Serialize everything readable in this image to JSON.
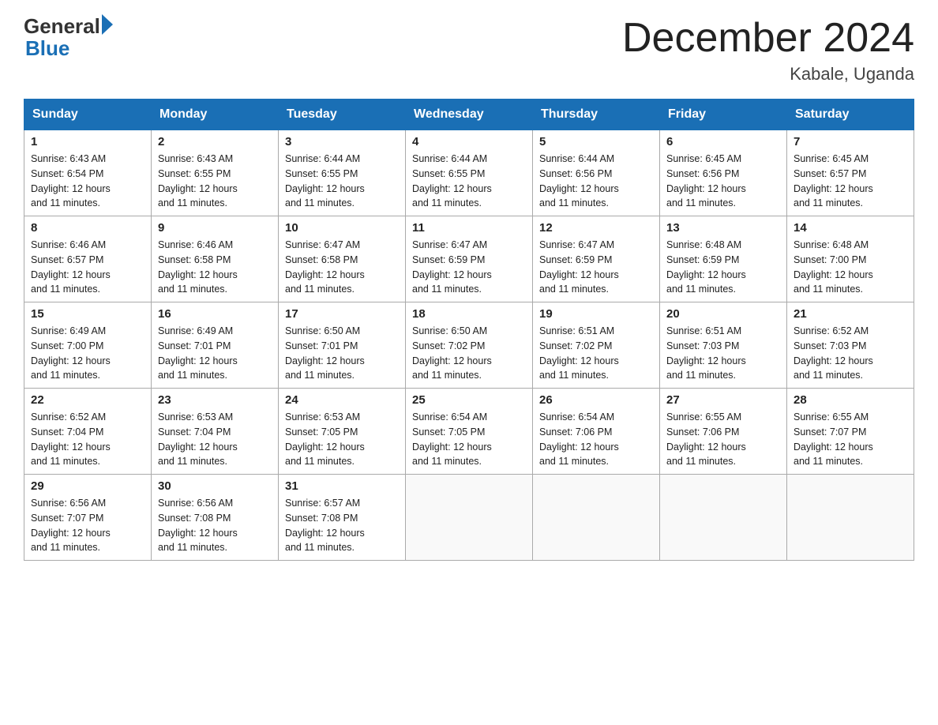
{
  "header": {
    "logo_general": "General",
    "logo_blue": "Blue",
    "title": "December 2024",
    "location": "Kabale, Uganda"
  },
  "days_of_week": [
    "Sunday",
    "Monday",
    "Tuesday",
    "Wednesday",
    "Thursday",
    "Friday",
    "Saturday"
  ],
  "weeks": [
    [
      {
        "num": "1",
        "sunrise": "6:43 AM",
        "sunset": "6:54 PM",
        "daylight": "12 hours and 11 minutes."
      },
      {
        "num": "2",
        "sunrise": "6:43 AM",
        "sunset": "6:55 PM",
        "daylight": "12 hours and 11 minutes."
      },
      {
        "num": "3",
        "sunrise": "6:44 AM",
        "sunset": "6:55 PM",
        "daylight": "12 hours and 11 minutes."
      },
      {
        "num": "4",
        "sunrise": "6:44 AM",
        "sunset": "6:55 PM",
        "daylight": "12 hours and 11 minutes."
      },
      {
        "num": "5",
        "sunrise": "6:44 AM",
        "sunset": "6:56 PM",
        "daylight": "12 hours and 11 minutes."
      },
      {
        "num": "6",
        "sunrise": "6:45 AM",
        "sunset": "6:56 PM",
        "daylight": "12 hours and 11 minutes."
      },
      {
        "num": "7",
        "sunrise": "6:45 AM",
        "sunset": "6:57 PM",
        "daylight": "12 hours and 11 minutes."
      }
    ],
    [
      {
        "num": "8",
        "sunrise": "6:46 AM",
        "sunset": "6:57 PM",
        "daylight": "12 hours and 11 minutes."
      },
      {
        "num": "9",
        "sunrise": "6:46 AM",
        "sunset": "6:58 PM",
        "daylight": "12 hours and 11 minutes."
      },
      {
        "num": "10",
        "sunrise": "6:47 AM",
        "sunset": "6:58 PM",
        "daylight": "12 hours and 11 minutes."
      },
      {
        "num": "11",
        "sunrise": "6:47 AM",
        "sunset": "6:59 PM",
        "daylight": "12 hours and 11 minutes."
      },
      {
        "num": "12",
        "sunrise": "6:47 AM",
        "sunset": "6:59 PM",
        "daylight": "12 hours and 11 minutes."
      },
      {
        "num": "13",
        "sunrise": "6:48 AM",
        "sunset": "6:59 PM",
        "daylight": "12 hours and 11 minutes."
      },
      {
        "num": "14",
        "sunrise": "6:48 AM",
        "sunset": "7:00 PM",
        "daylight": "12 hours and 11 minutes."
      }
    ],
    [
      {
        "num": "15",
        "sunrise": "6:49 AM",
        "sunset": "7:00 PM",
        "daylight": "12 hours and 11 minutes."
      },
      {
        "num": "16",
        "sunrise": "6:49 AM",
        "sunset": "7:01 PM",
        "daylight": "12 hours and 11 minutes."
      },
      {
        "num": "17",
        "sunrise": "6:50 AM",
        "sunset": "7:01 PM",
        "daylight": "12 hours and 11 minutes."
      },
      {
        "num": "18",
        "sunrise": "6:50 AM",
        "sunset": "7:02 PM",
        "daylight": "12 hours and 11 minutes."
      },
      {
        "num": "19",
        "sunrise": "6:51 AM",
        "sunset": "7:02 PM",
        "daylight": "12 hours and 11 minutes."
      },
      {
        "num": "20",
        "sunrise": "6:51 AM",
        "sunset": "7:03 PM",
        "daylight": "12 hours and 11 minutes."
      },
      {
        "num": "21",
        "sunrise": "6:52 AM",
        "sunset": "7:03 PM",
        "daylight": "12 hours and 11 minutes."
      }
    ],
    [
      {
        "num": "22",
        "sunrise": "6:52 AM",
        "sunset": "7:04 PM",
        "daylight": "12 hours and 11 minutes."
      },
      {
        "num": "23",
        "sunrise": "6:53 AM",
        "sunset": "7:04 PM",
        "daylight": "12 hours and 11 minutes."
      },
      {
        "num": "24",
        "sunrise": "6:53 AM",
        "sunset": "7:05 PM",
        "daylight": "12 hours and 11 minutes."
      },
      {
        "num": "25",
        "sunrise": "6:54 AM",
        "sunset": "7:05 PM",
        "daylight": "12 hours and 11 minutes."
      },
      {
        "num": "26",
        "sunrise": "6:54 AM",
        "sunset": "7:06 PM",
        "daylight": "12 hours and 11 minutes."
      },
      {
        "num": "27",
        "sunrise": "6:55 AM",
        "sunset": "7:06 PM",
        "daylight": "12 hours and 11 minutes."
      },
      {
        "num": "28",
        "sunrise": "6:55 AM",
        "sunset": "7:07 PM",
        "daylight": "12 hours and 11 minutes."
      }
    ],
    [
      {
        "num": "29",
        "sunrise": "6:56 AM",
        "sunset": "7:07 PM",
        "daylight": "12 hours and 11 minutes."
      },
      {
        "num": "30",
        "sunrise": "6:56 AM",
        "sunset": "7:08 PM",
        "daylight": "12 hours and 11 minutes."
      },
      {
        "num": "31",
        "sunrise": "6:57 AM",
        "sunset": "7:08 PM",
        "daylight": "12 hours and 11 minutes."
      },
      null,
      null,
      null,
      null
    ]
  ],
  "labels": {
    "sunrise": "Sunrise:",
    "sunset": "Sunset:",
    "daylight": "Daylight:"
  }
}
